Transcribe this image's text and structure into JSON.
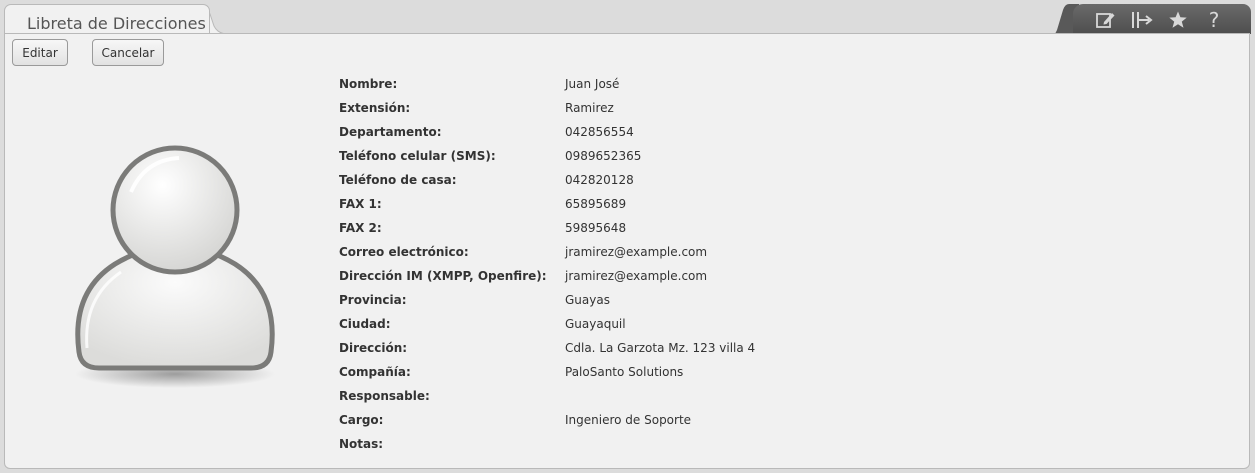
{
  "tab": {
    "title": "Libreta de Direcciones"
  },
  "toolbar": {
    "icons": [
      "edit-icon",
      "export-icon",
      "star-icon",
      "help-icon"
    ]
  },
  "actions": {
    "edit_label": "Editar",
    "cancel_label": "Cancelar"
  },
  "contact": {
    "fields": [
      {
        "label": "Nombre:",
        "value": "Juan José"
      },
      {
        "label": "Extensión:",
        "value": "Ramirez"
      },
      {
        "label": "Departamento:",
        "value": "042856554"
      },
      {
        "label": "Teléfono celular (SMS):",
        "value": "0989652365"
      },
      {
        "label": "Teléfono de casa:",
        "value": "042820128"
      },
      {
        "label": "FAX 1:",
        "value": "65895689"
      },
      {
        "label": "FAX 2:",
        "value": "59895648"
      },
      {
        "label": "Correo electrónico:",
        "value": "jramirez@example.com"
      },
      {
        "label": "Dirección IM (XMPP, Openfire):",
        "value": "jramirez@example.com"
      },
      {
        "label": "Provincia:",
        "value": "Guayas"
      },
      {
        "label": "Ciudad:",
        "value": "Guayaquil"
      },
      {
        "label": "Dirección:",
        "value": "Cdla. La Garzota Mz. 123 villa 4"
      },
      {
        "label": "Compañía:",
        "value": "PaloSanto Solutions"
      },
      {
        "label": "Responsable:",
        "value": ""
      },
      {
        "label": "Cargo:",
        "value": "Ingeniero de Soporte"
      },
      {
        "label": "Notas:",
        "value": ""
      }
    ]
  },
  "colors": {
    "panel_bg": "#f1f1f1",
    "toolbar_bg": "#555555",
    "text": "#333333"
  }
}
